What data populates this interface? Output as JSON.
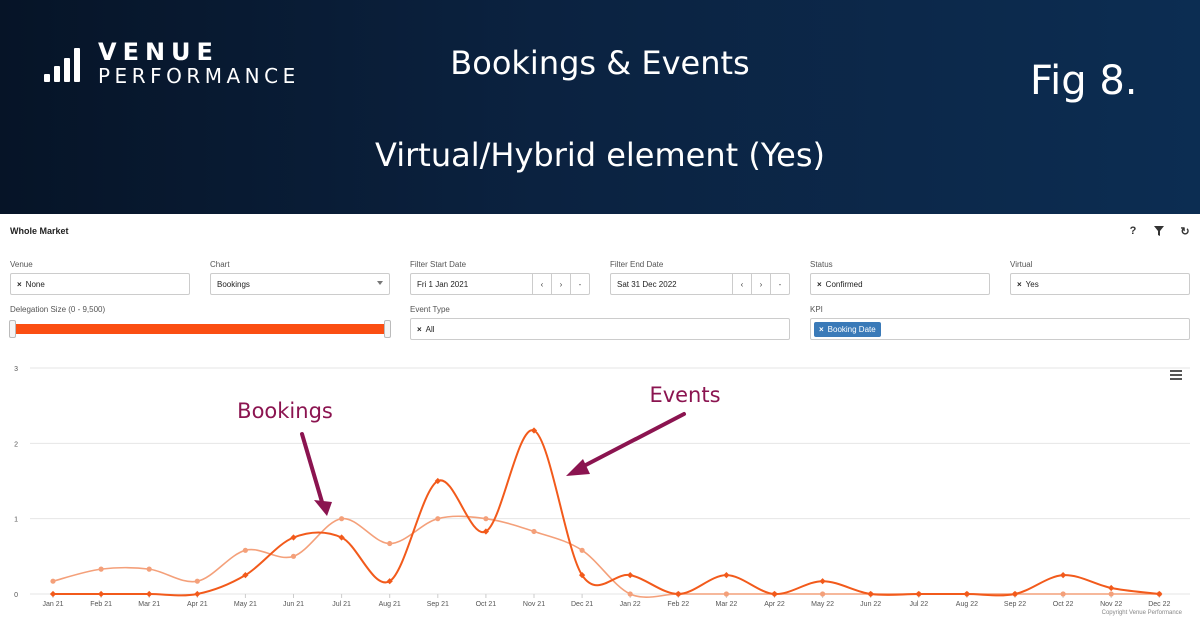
{
  "banner": {
    "logo_line1": "VENUE",
    "logo_line2": "PERFORMANCE",
    "title": "Bookings & Events",
    "subtitle": "Virtual/Hybrid element (Yes)",
    "fig_label": "Fig 8."
  },
  "panel": {
    "title": "Whole Market",
    "tools": [
      {
        "name": "help-icon",
        "glyph": "?"
      },
      {
        "name": "filter-icon",
        "glyph": "▼"
      },
      {
        "name": "refresh-icon",
        "glyph": "↻"
      }
    ]
  },
  "filters": {
    "venue": {
      "label": "Venue",
      "value": "None"
    },
    "chart": {
      "label": "Chart",
      "value": "Bookings"
    },
    "start_date": {
      "label": "Filter Start Date",
      "value": "Fri 1 Jan 2021"
    },
    "end_date": {
      "label": "Filter End Date",
      "value": "Sat 31 Dec 2022"
    },
    "status": {
      "label": "Status",
      "value": "Confirmed"
    },
    "virtual": {
      "label": "Virtual",
      "value": "Yes"
    },
    "delegation": {
      "label": "Delegation Size (0 - 9,500)",
      "min": 0,
      "max": 9500
    },
    "event_type": {
      "label": "Event Type",
      "value": "All"
    },
    "kpi": {
      "label": "KPI",
      "value": "Booking Date"
    },
    "date_buttons": [
      "‹",
      "›",
      "-"
    ]
  },
  "chart_data": {
    "type": "line",
    "categories": [
      "Jan 21",
      "Feb 21",
      "Mar 21",
      "Apr 21",
      "May 21",
      "Jun 21",
      "Jul 21",
      "Aug 21",
      "Sep 21",
      "Oct 21",
      "Nov 21",
      "Dec 21",
      "Jan 22",
      "Feb 22",
      "Mar 22",
      "Apr 22",
      "May 22",
      "Jun 22",
      "Jul 22",
      "Aug 22",
      "Sep 22",
      "Oct 22",
      "Nov 22",
      "Dec 22"
    ],
    "yticks": [
      0,
      1,
      2,
      3
    ],
    "ylim": [
      0,
      3
    ],
    "grid": true,
    "series": [
      {
        "name": "Bookings",
        "color": "#f4a07a",
        "values": [
          0.17,
          0.33,
          0.33,
          0.17,
          0.58,
          0.5,
          1.0,
          0.67,
          1.0,
          1.0,
          0.83,
          0.58,
          0,
          0,
          0,
          0,
          0,
          0,
          0,
          0,
          0,
          0,
          0,
          0
        ]
      },
      {
        "name": "Events",
        "color": "#f25a1b",
        "values": [
          0,
          0,
          0,
          0,
          0.25,
          0.75,
          0.75,
          0.17,
          1.5,
          0.83,
          2.17,
          0.25,
          0.25,
          0,
          0.25,
          0,
          0.17,
          0,
          0,
          0,
          0,
          0.25,
          0.08,
          0
        ]
      }
    ],
    "annotations": [
      {
        "text": "Bookings",
        "color": "#8b1450"
      },
      {
        "text": "Events",
        "color": "#8b1450"
      }
    ],
    "copyright": "Copyright Venue Performance"
  }
}
